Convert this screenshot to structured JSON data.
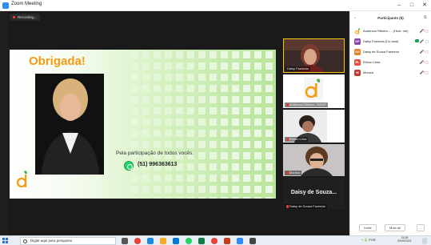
{
  "window": {
    "title": "Zoom Meeting",
    "controls": [
      "–",
      "□",
      "✕"
    ]
  },
  "recording": {
    "label": "Recording..."
  },
  "slide": {
    "title": "Obrigada!",
    "thanks_text": "Pela participação de todos vocês.",
    "phone": "(51) 996363613"
  },
  "video_strip": [
    {
      "name": "Daisy Fazenda"
    },
    {
      "name": "Anderson Ribeiro - DSOP"
    },
    {
      "name": "Ebiron Lima"
    },
    {
      "name": "Monica"
    },
    {
      "name": "Daisy de Souza Fazenda",
      "display_name": "Daisy de Souza..."
    }
  ],
  "participants_panel": {
    "title": "Participants (5)",
    "rows": [
      {
        "initials": "",
        "name": "Anderson Ribeiro -... (Host, me)",
        "color": "#f39c12"
      },
      {
        "initials": "DF",
        "name": "Daisy Fazenda (Co-host)",
        "color": "#8e44ad"
      },
      {
        "initials": "DS",
        "name": "Daisy de Souza Fazenda",
        "color": "#e67e22"
      },
      {
        "initials": "EL",
        "name": "Ebiron Lima",
        "color": "#e74c3c"
      },
      {
        "initials": "M",
        "name": "Monica",
        "color": "#c0392b"
      }
    ],
    "buttons": {
      "invite": "Invite",
      "mute_all": "Mute All",
      "more": "..."
    }
  },
  "taskbar": {
    "search_placeholder": "Digite aqui para pesquisar",
    "tray_text": "^ 🔋 POR",
    "time": "15:26",
    "date": "09/09/2021"
  },
  "colors": {
    "slide_title": "#f39c12",
    "whatsapp": "#25d366",
    "accent": "#2d8cff",
    "active_speaker_border": "#f5c518"
  }
}
